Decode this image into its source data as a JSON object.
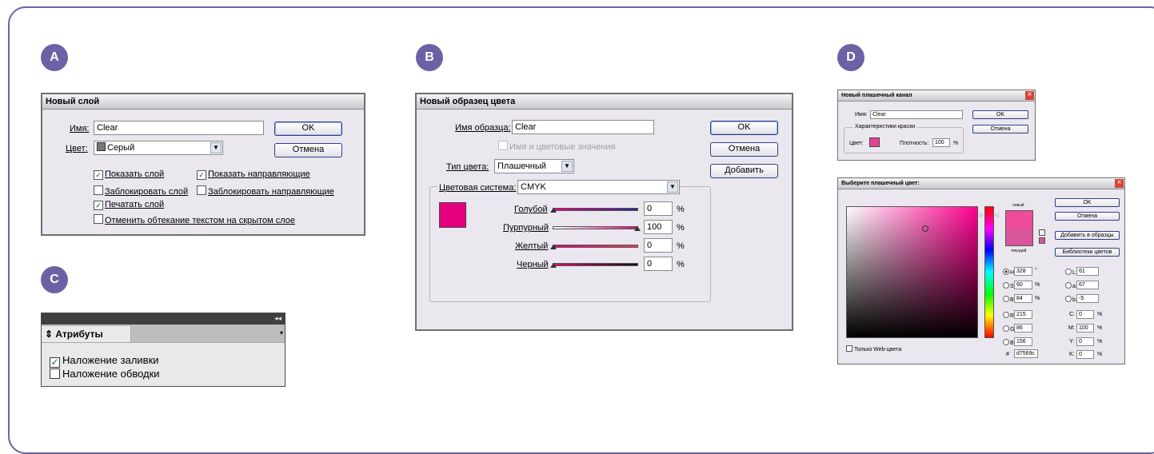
{
  "badges": {
    "a": "A",
    "b": "B",
    "c": "C",
    "d": "D"
  },
  "dialog_a": {
    "title": "Новый слой",
    "name_label": "Имя:",
    "name_value": "Clear",
    "color_label": "Цвет:",
    "color_value": "Серый",
    "ok_label": "OK",
    "cancel_label": "Отмена",
    "checkboxes": [
      {
        "label": "Показать слой",
        "checked": true
      },
      {
        "label": "Показать направляющие",
        "checked": true
      },
      {
        "label": "Заблокировать слой",
        "checked": false
      },
      {
        "label": "Заблокировать направляющие",
        "checked": false
      },
      {
        "label": "Печатать слой",
        "checked": true
      },
      {
        "label": "Отменить обтекание текстом на скрытом слое",
        "checked": false
      }
    ],
    "checkmark": "✓"
  },
  "dialog_b": {
    "title": "Новый образец цвета",
    "swatch_name_label": "Имя образца:",
    "swatch_name_value": "Clear",
    "name_and_values_label": "Имя и цветовые значения",
    "color_type_label": "Тип цвета:",
    "color_type_value": "Плашечный",
    "color_system_label": "Цветовая система:",
    "color_system_value": "CMYK",
    "swatch_color": "#e4007d",
    "ok_label": "OK",
    "cancel_label": "Отмена",
    "add_label": "Добавить",
    "channels": [
      {
        "label": "Голубой",
        "value": "0",
        "unit": "%"
      },
      {
        "label": "Пурпурный",
        "value": "100",
        "unit": "%"
      },
      {
        "label": "Желтый",
        "value": "0",
        "unit": "%"
      },
      {
        "label": "Черный",
        "value": "0",
        "unit": "%"
      }
    ]
  },
  "panel_c": {
    "collapse_icon": "◂◂",
    "tab_label": "Атрибуты",
    "tab_icon": "⇕",
    "items": [
      {
        "label": "Наложение заливки",
        "checked": true
      },
      {
        "label": "Наложение обводки",
        "checked": false
      }
    ],
    "checkmark": "✓"
  },
  "dialog_d1": {
    "title": "Новый плашечный канал",
    "name_label": "Имя:",
    "name_value": "Clear",
    "ink_group_label": "Характеристики краски",
    "color_label": "Цвет:",
    "color_value": "#e8438f",
    "density_label": "Плотность:",
    "density_value": "100",
    "density_unit": "%",
    "ok_label": "OK",
    "cancel_label": "Отмена",
    "close_icon": "×"
  },
  "dialog_d2": {
    "title": "Выберите плашечный цвет:",
    "close_icon": "×",
    "new_label": "новый",
    "current_label": "текущий",
    "new_color": "#ee4c9a",
    "current_color": "#d7569c",
    "ok_label": "OK",
    "cancel_label": "Отмена",
    "add_to_swatches_label": "Добавить в образцы",
    "color_libraries_label": "Библиотеки цветов",
    "web_only_label": "Только Web-цвета",
    "hex_label": "#",
    "hex_value": "d7569c",
    "hsb": [
      {
        "label": "H:",
        "value": "328",
        "unit": "°"
      },
      {
        "label": "S:",
        "value": "60",
        "unit": "%"
      },
      {
        "label": "B:",
        "value": "84",
        "unit": "%"
      }
    ],
    "rgb": [
      {
        "label": "R:",
        "value": "215"
      },
      {
        "label": "G:",
        "value": "86"
      },
      {
        "label": "B:",
        "value": "156"
      }
    ],
    "lab": [
      {
        "label": "L:",
        "value": "61"
      },
      {
        "label": "a:",
        "value": "67"
      },
      {
        "label": "b:",
        "value": "-5"
      }
    ],
    "cmyk": [
      {
        "label": "C:",
        "value": "0",
        "unit": "%"
      },
      {
        "label": "M:",
        "value": "100",
        "unit": "%"
      },
      {
        "label": "Y:",
        "value": "0",
        "unit": "%"
      },
      {
        "label": "K:",
        "value": "0",
        "unit": "%"
      }
    ],
    "picker_hue": "#ff0090"
  }
}
